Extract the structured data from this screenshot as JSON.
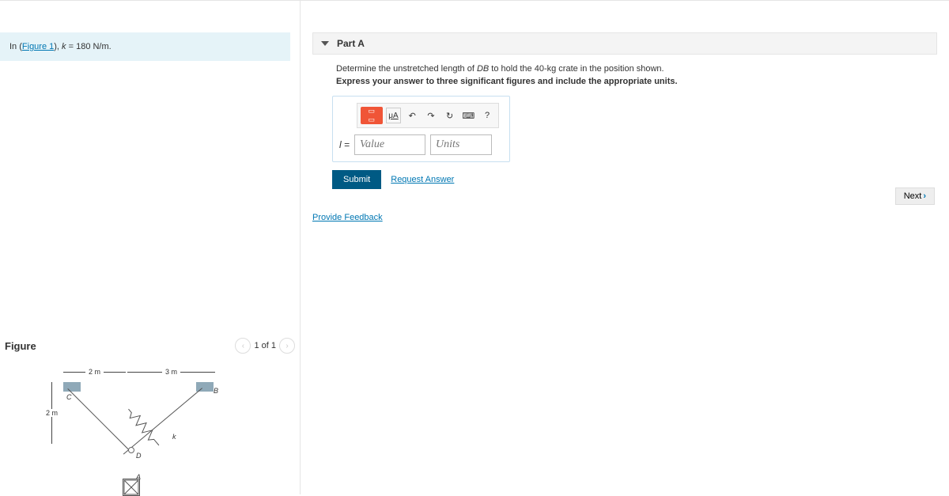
{
  "problem": {
    "prefix": "In (",
    "figure_link": "Figure 1",
    "mid": "), ",
    "var": "k",
    "eq": " = 180 N/m."
  },
  "figure": {
    "heading": "Figure",
    "pager": "1 of 1",
    "dim2m": "2 m",
    "dim3m": "3 m",
    "dimV": "2 m",
    "lblC": "C",
    "lblB": "B",
    "lblD": "D",
    "lblA": "A",
    "lblk": "k"
  },
  "part": {
    "title": "Part A",
    "line1a": "Determine the unstretched length of ",
    "line1db": "DB",
    "line1b": " to hold the 40-kg crate in the position shown.",
    "line2": "Express your answer to three significant figures and include the appropriate units."
  },
  "toolbar": {
    "ua": "μA",
    "undo": "↶",
    "redo": "↷",
    "reset": "↻",
    "keyb": "⌨",
    "help": "?"
  },
  "input": {
    "label": "l =",
    "value_ph": "Value",
    "units_ph": "Units"
  },
  "actions": {
    "submit": "Submit",
    "request": "Request Answer",
    "feedback": "Provide Feedback",
    "next": "Next"
  }
}
